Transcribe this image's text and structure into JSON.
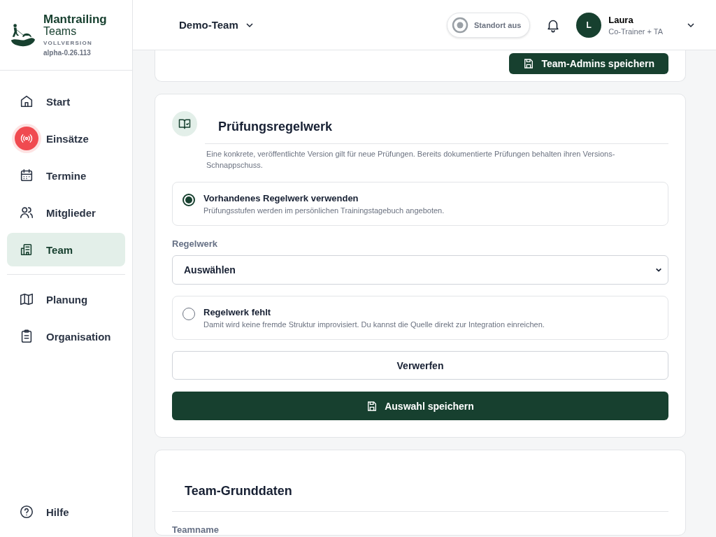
{
  "brand": {
    "name_line1": "Mantrailing",
    "name_line2": "Teams",
    "edition": "VOLLVERSION",
    "version": "alpha-0.26.113"
  },
  "sidebar": {
    "main_items": [
      {
        "label": "Start",
        "selected": false
      },
      {
        "label": "Einsätze",
        "selected": false
      },
      {
        "label": "Termine",
        "selected": false
      },
      {
        "label": "Mitglieder",
        "selected": false
      },
      {
        "label": "Team",
        "selected": true
      }
    ],
    "more_items": [
      {
        "label": "Planung",
        "selected": false
      },
      {
        "label": "Organisation",
        "selected": false
      }
    ],
    "help": "Hilfe"
  },
  "header": {
    "team": "Demo-Team",
    "location": "Standort aus",
    "user": {
      "initial": "L",
      "name": "Laura",
      "role": "Co-Trainer + TA"
    }
  },
  "previous_card": {
    "button": "Team-Admins speichern"
  },
  "rules_card": {
    "title": "Prüfungsregelwerk",
    "description": "Eine konkrete, veröffentlichte Version gilt für neue Prüfungen. Bereits dokumentierte Prüfungen behalten ihren Versions-Schnappschuss.",
    "options": [
      {
        "title": "Vorhandenes Regelwerk verwenden",
        "text": "Prüfungsstufen werden im persönlichen Trainingstagebuch angeboten.",
        "selected": true
      },
      {
        "title": "Regelwerk fehlt",
        "text": "Damit wird keine fremde Struktur improvisiert. Du kannst die Quelle direkt zur Integration einreichen.",
        "selected": false
      }
    ],
    "select_label": "Regelwerk",
    "select_value": "Auswählen",
    "discard": "Verwerfen",
    "save": "Auswahl speichern"
  },
  "basics_card": {
    "title": "Team-Grunddaten",
    "field_label": "Teamname"
  }
}
